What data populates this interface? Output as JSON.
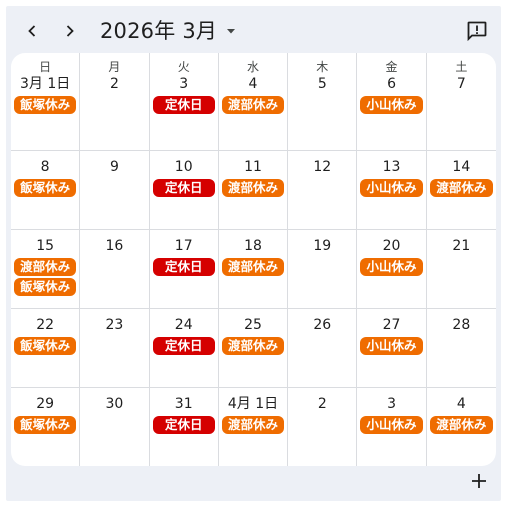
{
  "header": {
    "month_title": "2026年 3月",
    "prev_icon": "chevron-left-icon",
    "next_icon": "chevron-right-icon",
    "dropdown_icon": "caret-down-icon",
    "feedback_icon": "feedback-icon"
  },
  "colors": {
    "orange": "#ef6c00",
    "red": "#d50000",
    "frame": "#edf0f6"
  },
  "weekdays": [
    "日",
    "月",
    "火",
    "水",
    "木",
    "金",
    "土"
  ],
  "weeks": [
    [
      {
        "day": "3月 1日",
        "events": [
          {
            "label": "飯塚休み",
            "color": "orange"
          }
        ]
      },
      {
        "day": "2",
        "events": []
      },
      {
        "day": "3",
        "events": [
          {
            "label": "定休日",
            "color": "red"
          }
        ]
      },
      {
        "day": "4",
        "events": [
          {
            "label": "渡部休み",
            "color": "orange"
          }
        ]
      },
      {
        "day": "5",
        "events": []
      },
      {
        "day": "6",
        "events": [
          {
            "label": "小山休み",
            "color": "orange"
          }
        ]
      },
      {
        "day": "7",
        "events": []
      }
    ],
    [
      {
        "day": "8",
        "events": [
          {
            "label": "飯塚休み",
            "color": "orange"
          }
        ]
      },
      {
        "day": "9",
        "events": []
      },
      {
        "day": "10",
        "events": [
          {
            "label": "定休日",
            "color": "red"
          }
        ]
      },
      {
        "day": "11",
        "events": [
          {
            "label": "渡部休み",
            "color": "orange"
          }
        ]
      },
      {
        "day": "12",
        "events": []
      },
      {
        "day": "13",
        "events": [
          {
            "label": "小山休み",
            "color": "orange"
          }
        ]
      },
      {
        "day": "14",
        "events": [
          {
            "label": "渡部休み",
            "color": "orange"
          }
        ]
      }
    ],
    [
      {
        "day": "15",
        "events": [
          {
            "label": "渡部休み",
            "color": "orange"
          },
          {
            "label": "飯塚休み",
            "color": "orange"
          }
        ]
      },
      {
        "day": "16",
        "events": []
      },
      {
        "day": "17",
        "events": [
          {
            "label": "定休日",
            "color": "red"
          }
        ]
      },
      {
        "day": "18",
        "events": [
          {
            "label": "渡部休み",
            "color": "orange"
          }
        ]
      },
      {
        "day": "19",
        "events": []
      },
      {
        "day": "20",
        "events": [
          {
            "label": "小山休み",
            "color": "orange"
          }
        ]
      },
      {
        "day": "21",
        "events": []
      }
    ],
    [
      {
        "day": "22",
        "events": [
          {
            "label": "飯塚休み",
            "color": "orange"
          }
        ]
      },
      {
        "day": "23",
        "events": []
      },
      {
        "day": "24",
        "events": [
          {
            "label": "定休日",
            "color": "red"
          }
        ]
      },
      {
        "day": "25",
        "events": [
          {
            "label": "渡部休み",
            "color": "orange"
          }
        ]
      },
      {
        "day": "26",
        "events": []
      },
      {
        "day": "27",
        "events": [
          {
            "label": "小山休み",
            "color": "orange"
          }
        ]
      },
      {
        "day": "28",
        "events": []
      }
    ],
    [
      {
        "day": "29",
        "events": [
          {
            "label": "飯塚休み",
            "color": "orange"
          }
        ]
      },
      {
        "day": "30",
        "events": []
      },
      {
        "day": "31",
        "events": [
          {
            "label": "定休日",
            "color": "red"
          }
        ]
      },
      {
        "day": "4月 1日",
        "events": [
          {
            "label": "渡部休み",
            "color": "orange"
          }
        ]
      },
      {
        "day": "2",
        "events": []
      },
      {
        "day": "3",
        "events": [
          {
            "label": "小山休み",
            "color": "orange"
          }
        ]
      },
      {
        "day": "4",
        "events": [
          {
            "label": "渡部休み",
            "color": "orange"
          }
        ]
      }
    ]
  ],
  "footer": {
    "add_icon": "plus-icon"
  }
}
